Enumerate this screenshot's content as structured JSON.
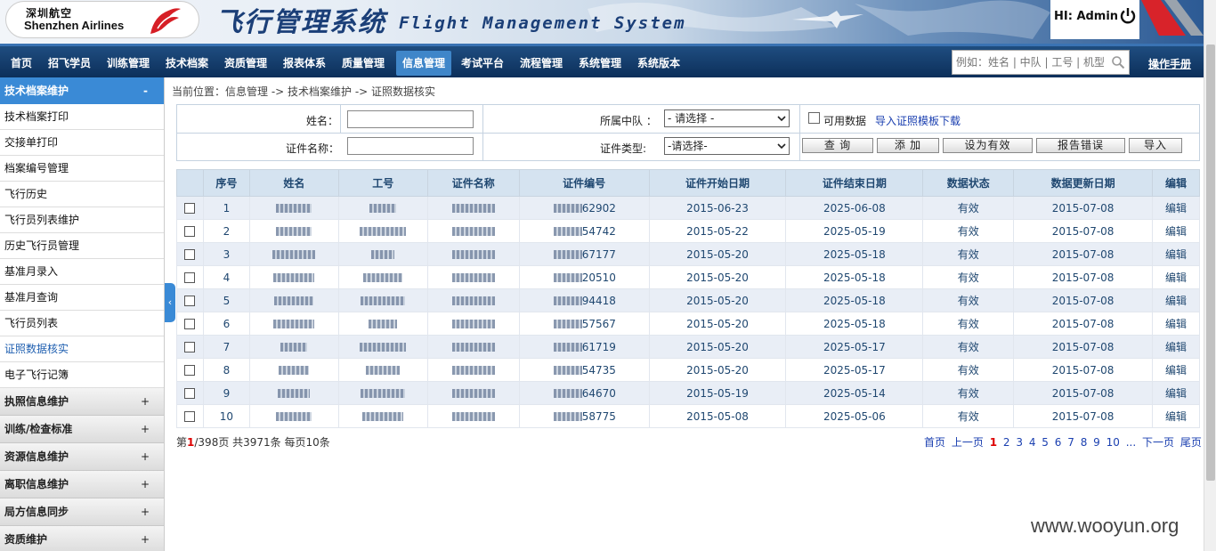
{
  "header": {
    "logo_cn": "深圳航空",
    "logo_en": "Shenzhen Airlines",
    "system_cn": "飞行管理系统",
    "system_en": "Flight Management System",
    "greeting": "HI: Admin"
  },
  "nav": {
    "items": [
      "首页",
      "招飞学员",
      "训练管理",
      "技术档案",
      "资质管理",
      "报表体系",
      "质量管理",
      "信息管理",
      "考试平台",
      "流程管理",
      "系统管理",
      "系统版本"
    ],
    "active": "信息管理",
    "search_placeholder": "例如：姓名 | 中队 | 工号 | 机型",
    "manual": "操作手册"
  },
  "sidebar": {
    "header": "技术档案维护",
    "header_sign": "-",
    "items": [
      "技术档案打印",
      "交接单打印",
      "档案编号管理",
      "飞行历史",
      "飞行员列表维护",
      "历史飞行员管理",
      "基准月录入",
      "基准月查询",
      "飞行员列表",
      "证照数据核实",
      "电子飞行记簿"
    ],
    "active_item": "证照数据核实",
    "groups": [
      "执照信息维护",
      "训练/检查标准",
      "资源信息维护",
      "离职信息维护",
      "局方信息同步",
      "资质维护"
    ],
    "group_sign": "+"
  },
  "breadcrumb": "当前位置：信息管理 -> 技术档案维护 -> 证照数据核实",
  "form": {
    "name_label": "姓名：",
    "name_value": "",
    "squadron_label": "所属中队 ：",
    "squadron_value": "- 请选择 -",
    "usable_label": "可用数据",
    "import_template_link": "导入证照模板下载",
    "cert_name_label": "证件名称：",
    "cert_name_value": "",
    "cert_type_label": "证件类型:",
    "cert_type_value": "-请选择-",
    "buttons": {
      "query": "查 询",
      "add": "添 加",
      "set_valid": "设为有效",
      "report_error": "报告错误",
      "import": "导入"
    }
  },
  "table": {
    "headers": [
      "序号",
      "姓名",
      "工号",
      "证件名称",
      "证件编号",
      "证件开始日期",
      "证件结束日期",
      "数据状态",
      "数据更新日期",
      "编辑"
    ],
    "rows": [
      {
        "no": "1",
        "cert_suffix": "62902",
        "start": "2015-06-23",
        "end": "2025-06-08",
        "status": "有效",
        "updated": "2015-07-08",
        "edit": "编辑"
      },
      {
        "no": "2",
        "cert_suffix": "54742",
        "start": "2015-05-22",
        "end": "2025-05-19",
        "status": "有效",
        "updated": "2015-07-08",
        "edit": "编辑"
      },
      {
        "no": "3",
        "cert_suffix": "67177",
        "start": "2015-05-20",
        "end": "2025-05-18",
        "status": "有效",
        "updated": "2015-07-08",
        "edit": "编辑"
      },
      {
        "no": "4",
        "cert_suffix": "20510",
        "start": "2015-05-20",
        "end": "2025-05-18",
        "status": "有效",
        "updated": "2015-07-08",
        "edit": "编辑"
      },
      {
        "no": "5",
        "cert_suffix": "94418",
        "start": "2015-05-20",
        "end": "2025-05-18",
        "status": "有效",
        "updated": "2015-07-08",
        "edit": "编辑"
      },
      {
        "no": "6",
        "cert_suffix": "57567",
        "start": "2015-05-20",
        "end": "2025-05-18",
        "status": "有效",
        "updated": "2015-07-08",
        "edit": "编辑"
      },
      {
        "no": "7",
        "cert_suffix": "61719",
        "start": "2015-05-20",
        "end": "2025-05-17",
        "status": "有效",
        "updated": "2015-07-08",
        "edit": "编辑"
      },
      {
        "no": "8",
        "cert_suffix": "54735",
        "start": "2015-05-20",
        "end": "2025-05-17",
        "status": "有效",
        "updated": "2015-07-08",
        "edit": "编辑"
      },
      {
        "no": "9",
        "cert_suffix": "64670",
        "start": "2015-05-19",
        "end": "2025-05-14",
        "status": "有效",
        "updated": "2015-07-08",
        "edit": "编辑"
      },
      {
        "no": "10",
        "cert_suffix": "58775",
        "start": "2015-05-08",
        "end": "2025-05-06",
        "status": "有效",
        "updated": "2015-07-08",
        "edit": "编辑"
      }
    ]
  },
  "pager": {
    "prefix": "第",
    "current": "1",
    "suffix": "/398页 共3971条 每页10条",
    "first": "首页",
    "prev": "上一页",
    "pages": [
      "1",
      "2",
      "3",
      "4",
      "5",
      "6",
      "7",
      "8",
      "9",
      "10"
    ],
    "ellipsis": "...",
    "next": "下一页",
    "last": "尾页"
  },
  "watermark": "www.wooyun.org",
  "colors": {
    "nav_bg": "#0c2f5a",
    "nav_active": "#3f86c9",
    "sidebar_head": "#3a8ad6",
    "table_head": "#d5e3f0",
    "link": "#1a3fb0",
    "current_page": "#dd0000"
  }
}
